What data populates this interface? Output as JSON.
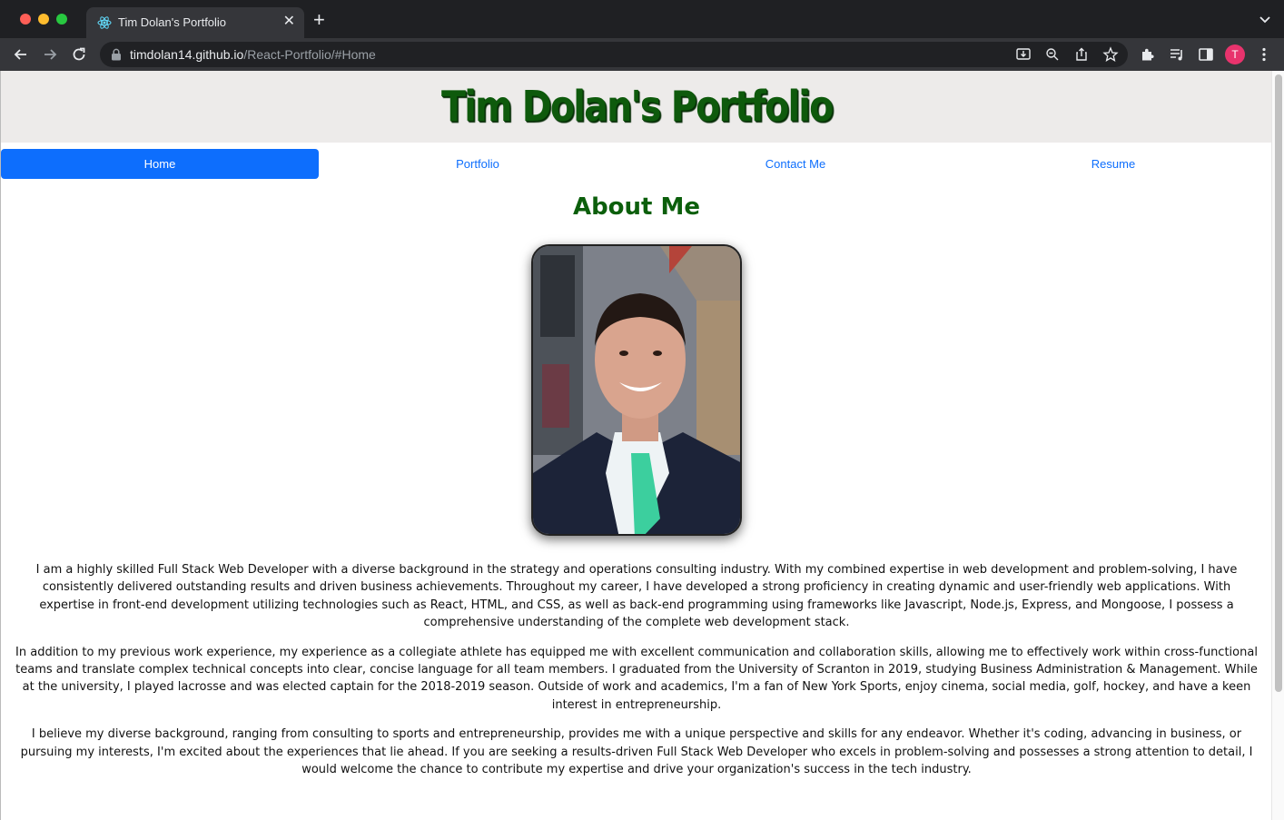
{
  "browser": {
    "tab_title": "Tim Dolan's Portfolio",
    "url_host": "timdolan14.github.io",
    "url_path": "/React-Portfolio/#Home",
    "profile_initial": "T"
  },
  "site": {
    "title": "Tim Dolan's Portfolio",
    "nav": [
      {
        "label": "Home",
        "active": true
      },
      {
        "label": "Portfolio",
        "active": false
      },
      {
        "label": "Contact Me",
        "active": false
      },
      {
        "label": "Resume",
        "active": false
      }
    ]
  },
  "about": {
    "heading": "About Me",
    "paragraphs": [
      "I am a highly skilled Full Stack Web Developer with a diverse background in the strategy and operations consulting industry. With my combined expertise in web development and problem-solving, I have consistently delivered outstanding results and driven business achievements. Throughout my career, I have developed a strong proficiency in creating dynamic and user-friendly web applications. With expertise in front-end development utilizing technologies such as React, HTML, and CSS, as well as back-end programming using frameworks like Javascript, Node.js, Express, and Mongoose, I possess a comprehensive understanding of the complete web development stack.",
      "In addition to my previous work experience, my experience as a collegiate athlete has equipped me with excellent communication and collaboration skills, allowing me to effectively work within cross-functional teams and translate complex technical concepts into clear, concise language for all team members. I graduated from the University of Scranton in 2019, studying Business Administration & Management. While at the university, I played lacrosse and was elected captain for the 2018-2019 season. Outside of work and academics, I'm a fan of New York Sports, enjoy cinema, social media, golf, hockey, and have a keen interest in entrepreneurship.",
      "I believe my diverse background, ranging from consulting to sports and entrepreneurship, provides me with a unique perspective and skills for any endeavor. Whether it's coding, advancing in business, or pursuing my interests, I'm excited about the experiences that lie ahead. If you are seeking a results-driven Full Stack Web Developer who excels in problem-solving and possesses a strong attention to detail, I would welcome the chance to contribute my expertise and drive your organization's success in the tech industry."
    ]
  },
  "colors": {
    "title_green": "#0e5a0c",
    "heading_green": "#0c5f0c",
    "nav_blue": "#0d6efd",
    "header_bg": "#edebea"
  },
  "icons": [
    "react-favicon-icon",
    "close-icon",
    "plus-icon",
    "chevron-down-icon",
    "back-arrow-icon",
    "forward-arrow-icon",
    "reload-icon",
    "lock-icon",
    "install-icon",
    "zoom-icon",
    "share-icon",
    "star-icon",
    "extensions-icon",
    "media-icon",
    "sidepanel-icon",
    "kebab-menu-icon"
  ]
}
